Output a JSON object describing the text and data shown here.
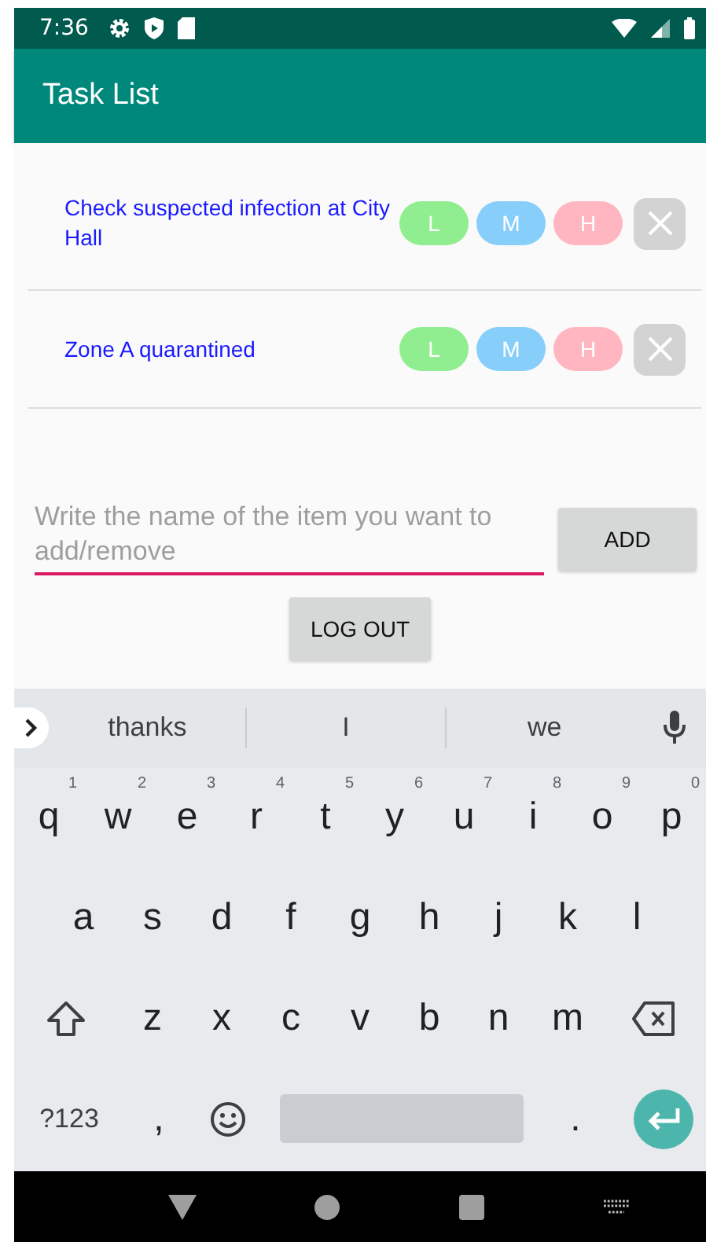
{
  "status_bar": {
    "time": "7:36"
  },
  "app_bar": {
    "title": "Task List"
  },
  "tasks": [
    {
      "name": "Check suspected infection at City Hall",
      "priorities": [
        {
          "label": "L",
          "color": "#90ee90"
        },
        {
          "label": "M",
          "color": "#87cefa"
        },
        {
          "label": "H",
          "color": "#ffb6c1"
        }
      ]
    },
    {
      "name": "Zone A quarantined",
      "priorities": [
        {
          "label": "L",
          "color": "#90ee90"
        },
        {
          "label": "M",
          "color": "#87cefa"
        },
        {
          "label": "H",
          "color": "#ffb6c1"
        }
      ]
    }
  ],
  "item_field": {
    "placeholder": "Write the name of the item you want to add/remove"
  },
  "add_button": "ADD",
  "logout_button": "LOG OUT",
  "keyboard": {
    "suggestions": [
      "thanks",
      "I",
      "we"
    ],
    "rows": [
      [
        {
          "key": "q",
          "hint": "1"
        },
        {
          "key": "w",
          "hint": "2"
        },
        {
          "key": "e",
          "hint": "3"
        },
        {
          "key": "r",
          "hint": "4"
        },
        {
          "key": "t",
          "hint": "5"
        },
        {
          "key": "y",
          "hint": "6"
        },
        {
          "key": "u",
          "hint": "7"
        },
        {
          "key": "i",
          "hint": "8"
        },
        {
          "key": "o",
          "hint": "9"
        },
        {
          "key": "p",
          "hint": "0"
        }
      ],
      [
        {
          "key": "a"
        },
        {
          "key": "s"
        },
        {
          "key": "d"
        },
        {
          "key": "f"
        },
        {
          "key": "g"
        },
        {
          "key": "h"
        },
        {
          "key": "j"
        },
        {
          "key": "k"
        },
        {
          "key": "l"
        }
      ],
      [
        {
          "key": "z"
        },
        {
          "key": "x"
        },
        {
          "key": "c"
        },
        {
          "key": "v"
        },
        {
          "key": "b"
        },
        {
          "key": "n"
        },
        {
          "key": "m"
        }
      ]
    ],
    "symbols_key": "?123",
    "comma_key": ",",
    "period_key": "."
  }
}
